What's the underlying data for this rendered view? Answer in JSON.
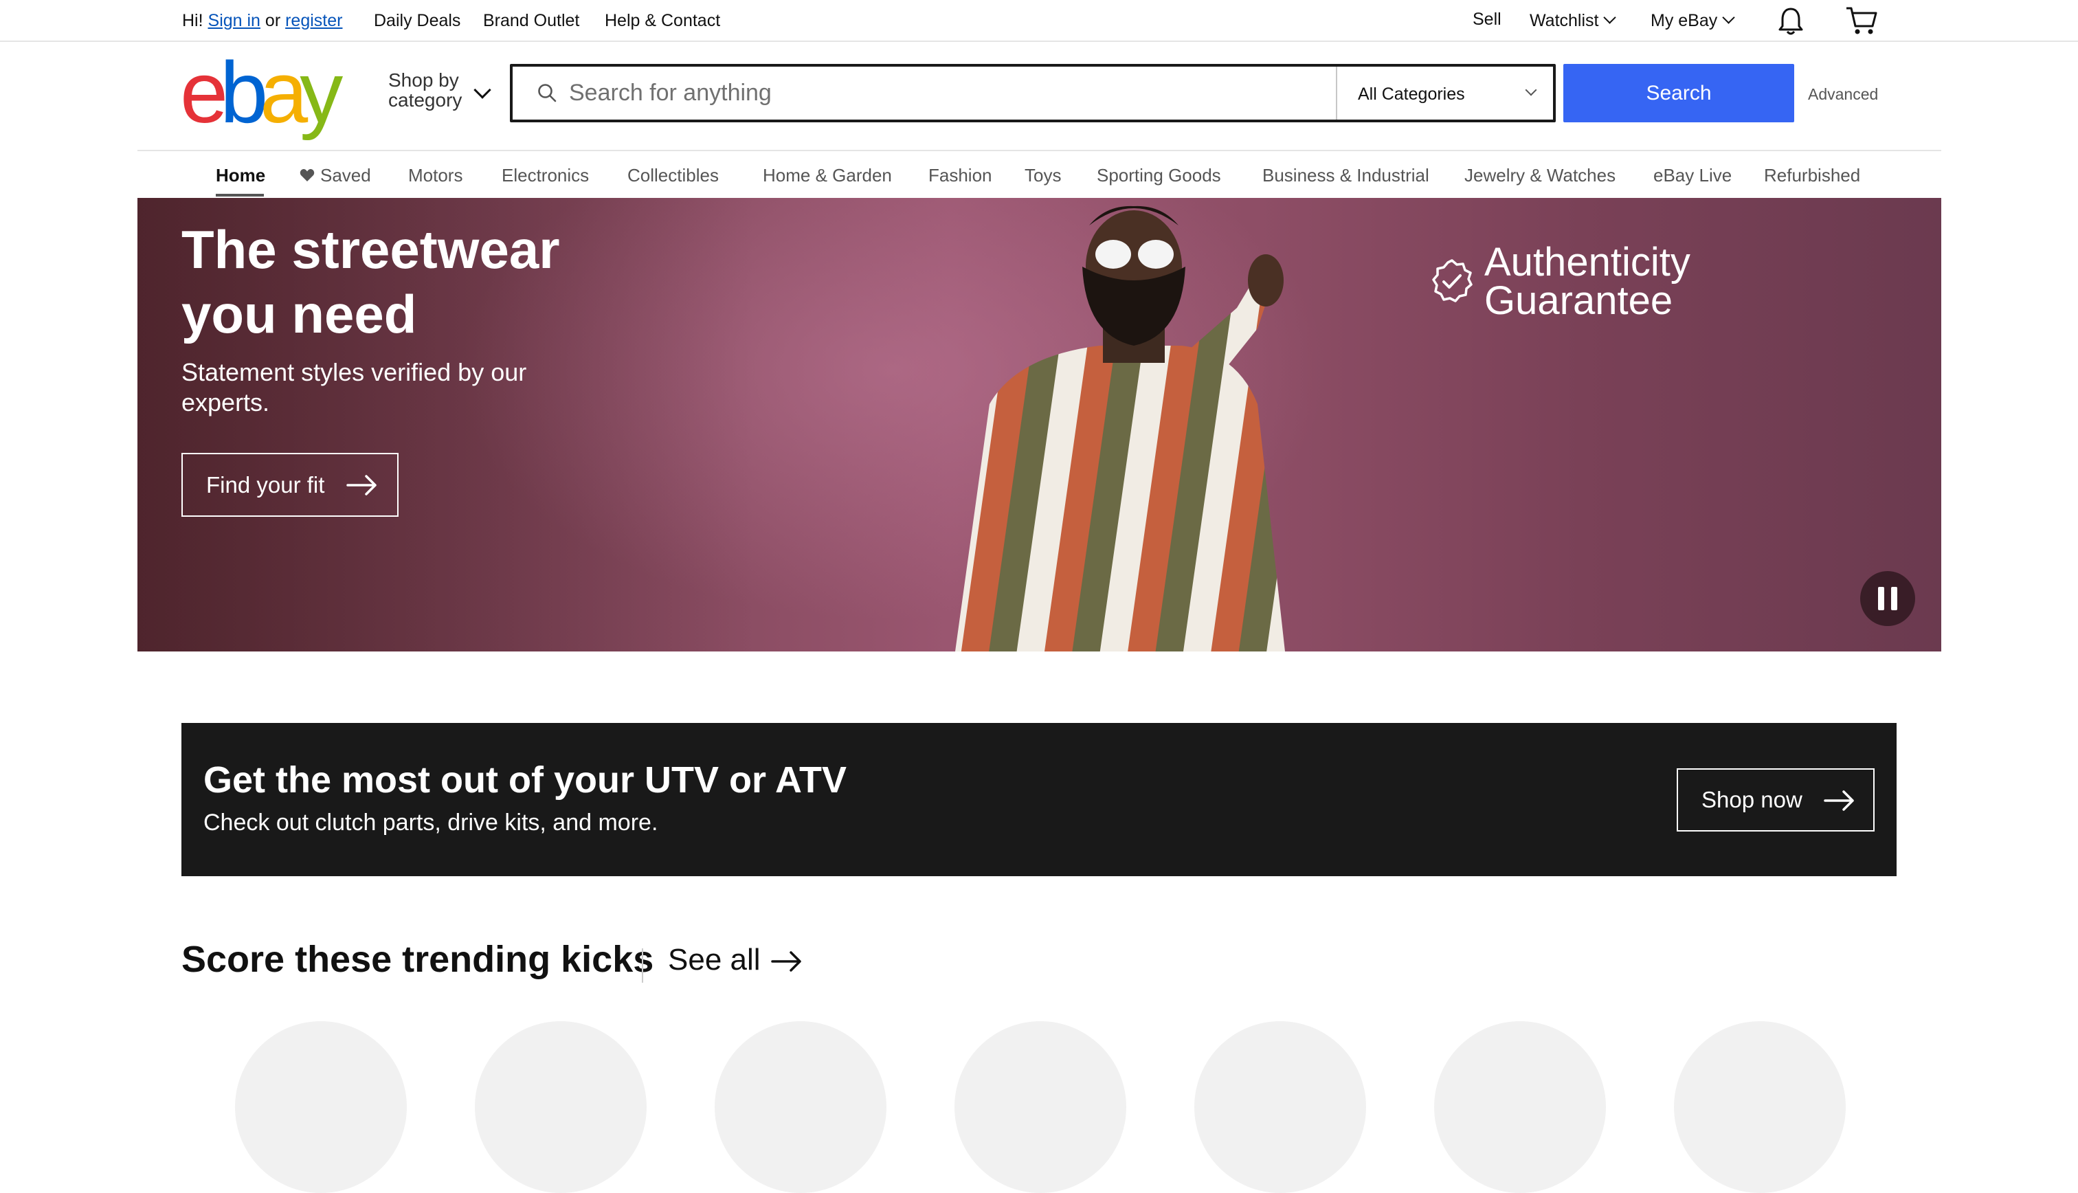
{
  "topbar": {
    "greeting": "Hi!",
    "sign_in": "Sign in",
    "or": "or",
    "register": "register",
    "daily_deals": "Daily Deals",
    "brand_outlet": "Brand Outlet",
    "help_contact": "Help & Contact",
    "sell": "Sell",
    "watchlist": "Watchlist",
    "my_ebay": "My eBay",
    "icons": [
      "chevron-down-icon",
      "bell-icon",
      "cart-icon"
    ]
  },
  "header": {
    "logo_letters": [
      "e",
      "b",
      "a",
      "y"
    ],
    "logo_colors": [
      "#e53238",
      "#0064d2",
      "#f5af02",
      "#86b817"
    ],
    "shop_by_line1": "Shop by",
    "shop_by_line2": "category",
    "search_placeholder": "Search for anything",
    "category_select": "All Categories",
    "search_button": "Search",
    "advanced": "Advanced",
    "accent_color": "#3665f3"
  },
  "nav": {
    "items": [
      "Home",
      "Saved",
      "Motors",
      "Electronics",
      "Collectibles",
      "Home & Garden",
      "Fashion",
      "Toys",
      "Sporting Goods",
      "Business & Industrial",
      "Jewelry & Watches",
      "eBay Live",
      "Refurbished"
    ],
    "active": "Home"
  },
  "hero": {
    "title": "The streetwear you need",
    "subtitle": "Statement styles verified by our experts.",
    "cta": "Find your fit",
    "badge": "Authenticity Guarantee",
    "icons": [
      "check-badge-icon",
      "pause-icon",
      "arrow-right-icon"
    ]
  },
  "promo": {
    "title": "Get the most out of your UTV or ATV",
    "subtitle": "Check out clutch parts, drive kits, and more.",
    "cta": "Shop now"
  },
  "trending": {
    "title": "Score these trending kicks",
    "see_all": "See all"
  }
}
